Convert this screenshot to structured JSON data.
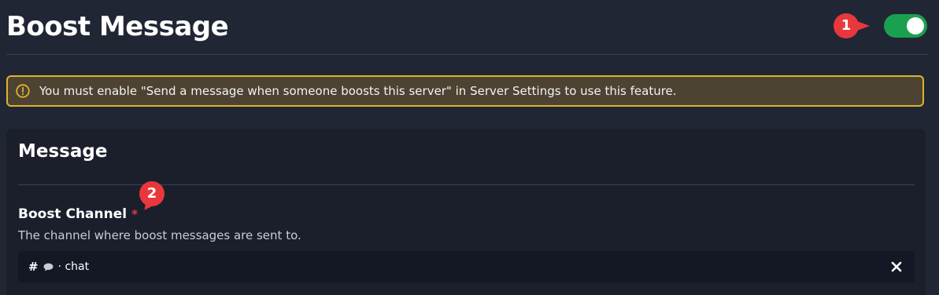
{
  "header": {
    "title": "Boost Message",
    "toggle_enabled": true,
    "toggle_color": "#1aa04f"
  },
  "annotations": {
    "marker_1": "1",
    "marker_2": "2",
    "marker_color": "#e8383d"
  },
  "warning": {
    "icon": "warning-circle-icon",
    "text": "You must enable \"Send a message when someone boosts this server\" in Server Settings to use this feature.",
    "border_color": "#e0b22e"
  },
  "message_section": {
    "title": "Message",
    "boost_channel": {
      "label": "Boost Channel",
      "required_mark": "*",
      "description": "The channel where boost messages are sent to.",
      "value": {
        "prefix": "#",
        "icon": "speech-bubble-icon",
        "name": "· chat"
      },
      "clear_icon": "close-icon"
    }
  }
}
